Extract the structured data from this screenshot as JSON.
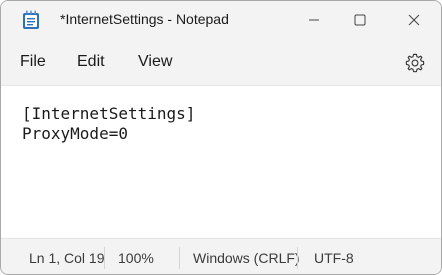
{
  "window": {
    "title": "*InternetSettings - Notepad",
    "app_icon": "notepad-icon"
  },
  "titlebar_buttons": {
    "minimize_icon": "minimize-icon",
    "maximize_icon": "maximize-icon",
    "close_icon": "close-icon"
  },
  "menu": {
    "file": "File",
    "edit": "Edit",
    "view": "View",
    "settings_icon": "gear-icon"
  },
  "editor": {
    "lines": [
      "[InternetSettings]",
      "ProxyMode=0"
    ]
  },
  "status": {
    "position": "Ln 1, Col 19",
    "zoom": "100%",
    "line_ending": "Windows (CRLF)",
    "encoding": "UTF-8"
  },
  "colors": {
    "chrome": "#f3f3f3",
    "editor_bg": "#ffffff",
    "text": "#1a1a1a",
    "icon_blue": "#2f6fb8"
  }
}
